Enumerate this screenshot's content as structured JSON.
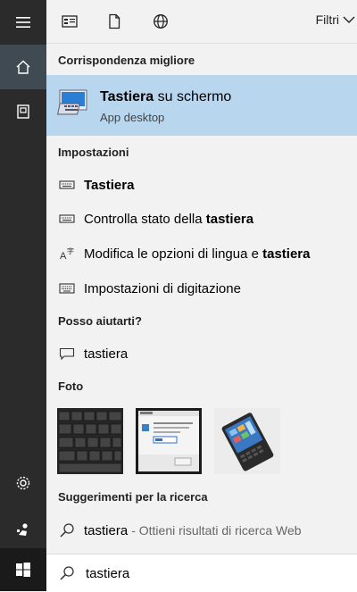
{
  "topbar": {
    "filter_label": "Filtri"
  },
  "best_match": {
    "section": "Corrispondenza migliore",
    "title_bold": "Tastiera",
    "title_rest": " su schermo",
    "subtitle": "App desktop"
  },
  "settings": {
    "section": "Impostazioni",
    "items": [
      {
        "pre": "",
        "bold": "Tastiera",
        "post": "",
        "icon": "keyboard-icon"
      },
      {
        "pre": "Controlla stato della ",
        "bold": "tastiera",
        "post": "",
        "icon": "keyboard-icon"
      },
      {
        "pre": "Modifica le opzioni di lingua e ",
        "bold": "tastiera",
        "post": "",
        "icon": "language-icon"
      },
      {
        "pre": "Impostazioni di digitazione",
        "bold": "",
        "post": "",
        "icon": "keyboard-icon"
      }
    ]
  },
  "help": {
    "section": "Posso aiutarti?",
    "item": "tastiera"
  },
  "photos": {
    "section": "Foto"
  },
  "suggestions": {
    "section": "Suggerimenti per la ricerca",
    "item": "tastiera",
    "hint": "- Ottieni risultati di ricerca Web"
  },
  "search": {
    "value": "tastiera"
  }
}
